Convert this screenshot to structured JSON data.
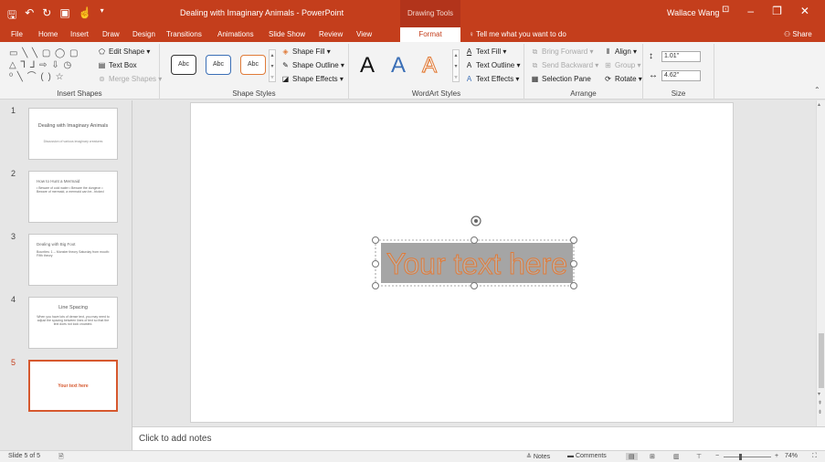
{
  "app": {
    "qat_icons": [
      "save-icon",
      "undo-icon",
      "redo-icon",
      "slideshow-icon",
      "touch-icon",
      "customize-icon"
    ],
    "doc_title": "Dealing with Imaginary Animals  -  PowerPoint",
    "contextual_tab": "Drawing Tools",
    "user_name": "Wallace Wang",
    "accent_color": "#c43e1c"
  },
  "tabs": [
    {
      "label": "File"
    },
    {
      "label": "Home"
    },
    {
      "label": "Insert"
    },
    {
      "label": "Draw"
    },
    {
      "label": "Design"
    },
    {
      "label": "Transitions"
    },
    {
      "label": "Animations"
    },
    {
      "label": "Slide Show"
    },
    {
      "label": "Review"
    },
    {
      "label": "View"
    },
    {
      "label": "Format"
    }
  ],
  "tellme": "Tell me what you want to do",
  "share_label": "Share",
  "ribbon": {
    "insert_shapes": {
      "label": "Insert Shapes",
      "shape_rows": [
        "▭ ╲ ╲ ▢ ◯ ▢",
        "△ ⅂ ⅃ ⇨ ⇩ ◷",
        "⁰ ╲ ⌒ ( ) ☆"
      ],
      "edit_shape": "Edit Shape",
      "text_box": "Text Box",
      "merge_shapes": "Merge Shapes"
    },
    "shape_styles": {
      "label": "Shape Styles",
      "preset_text": "Abc",
      "fill": "Shape Fill",
      "outline": "Shape Outline",
      "effects": "Shape Effects"
    },
    "wordart": {
      "label": "WordArt Styles",
      "preset_letter": "A",
      "text_fill": "Text Fill",
      "text_outline": "Text Outline",
      "text_effects": "Text Effects"
    },
    "arrange": {
      "label": "Arrange",
      "bring_forward": "Bring Forward",
      "send_backward": "Send Backward",
      "selection_pane": "Selection Pane",
      "align": "Align",
      "group": "Group",
      "rotate": "Rotate"
    },
    "size": {
      "label": "Size",
      "height": "1.01\"",
      "width": "4.62\""
    }
  },
  "slides": [
    {
      "num": "1",
      "title": "Dealing with Imaginary Animals",
      "subtitle": "Discussion of various imaginary creatures"
    },
    {
      "num": "2",
      "title": "How to Hunt a Mermaid",
      "bullets": "• Beware of cold water • Beware the dungeon • Beware of mermaid, a mermaid can be...tricked"
    },
    {
      "num": "3",
      "title": "Dealing with Big Foot",
      "bullets": "Bounties: 1 -- Monster theory     Saturday from mouth: Fifth theory"
    },
    {
      "num": "4",
      "title": "Line Spacing",
      "bullets": "When you have lots of dense text, you may need to adjust the spacing between lines of text so that the text does not look crowded."
    },
    {
      "num": "5",
      "title": "Your text here"
    }
  ],
  "active_slide": 5,
  "canvas": {
    "text": "Your text here"
  },
  "notes_placeholder": "Click to add notes",
  "status": {
    "slide_info": "Slide 5 of 5",
    "notes": "Notes",
    "comments": "Comments",
    "zoom": "74%",
    "zoom_value": 74
  }
}
